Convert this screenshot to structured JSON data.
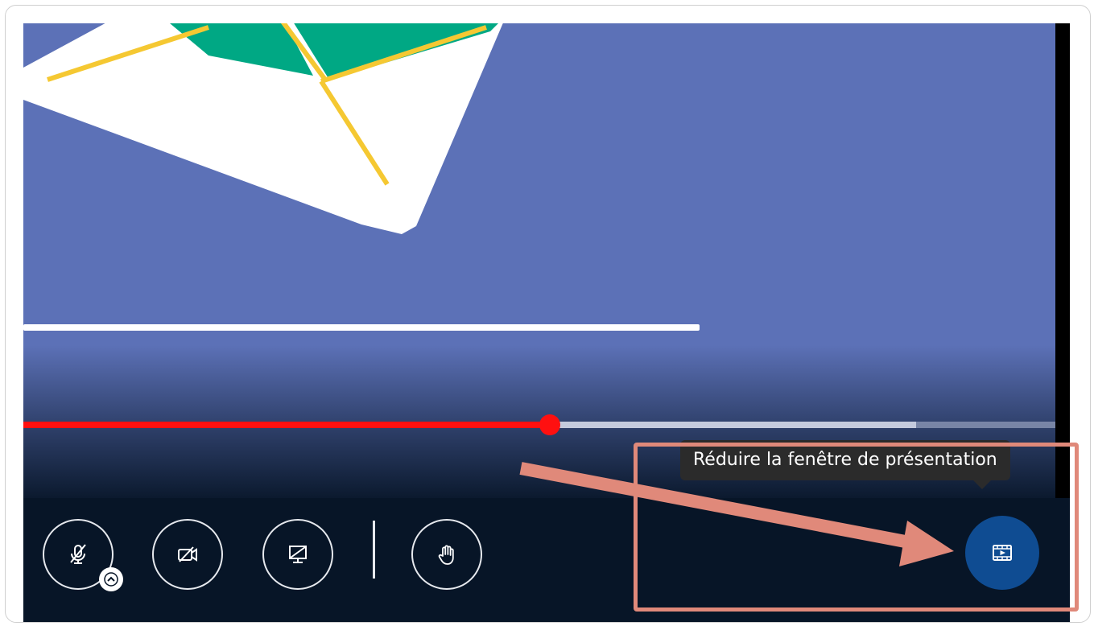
{
  "presentation": {
    "tooltip_text": "Réduire la fenêtre de présentation",
    "progress_fraction": 0.51,
    "buffered_fraction": 0.865
  },
  "controls": {
    "buttons": [
      {
        "name": "microphone-muted",
        "icon": "microphone-off-icon",
        "has_options": true
      },
      {
        "name": "camera-off",
        "icon": "camera-off-icon"
      },
      {
        "name": "screen-share-off",
        "icon": "screen-share-off-icon"
      },
      {
        "name": "raise-hand",
        "icon": "hand-icon"
      }
    ],
    "present_button_icon": "presentation-film-icon"
  },
  "colors": {
    "video_background": "#5c71b7",
    "progress_played": "#ff1010",
    "control_bar": "#071527",
    "present_button": "#0f4c92",
    "annotation": "#e0897a",
    "tooltip_background": "#2b2b2b"
  }
}
